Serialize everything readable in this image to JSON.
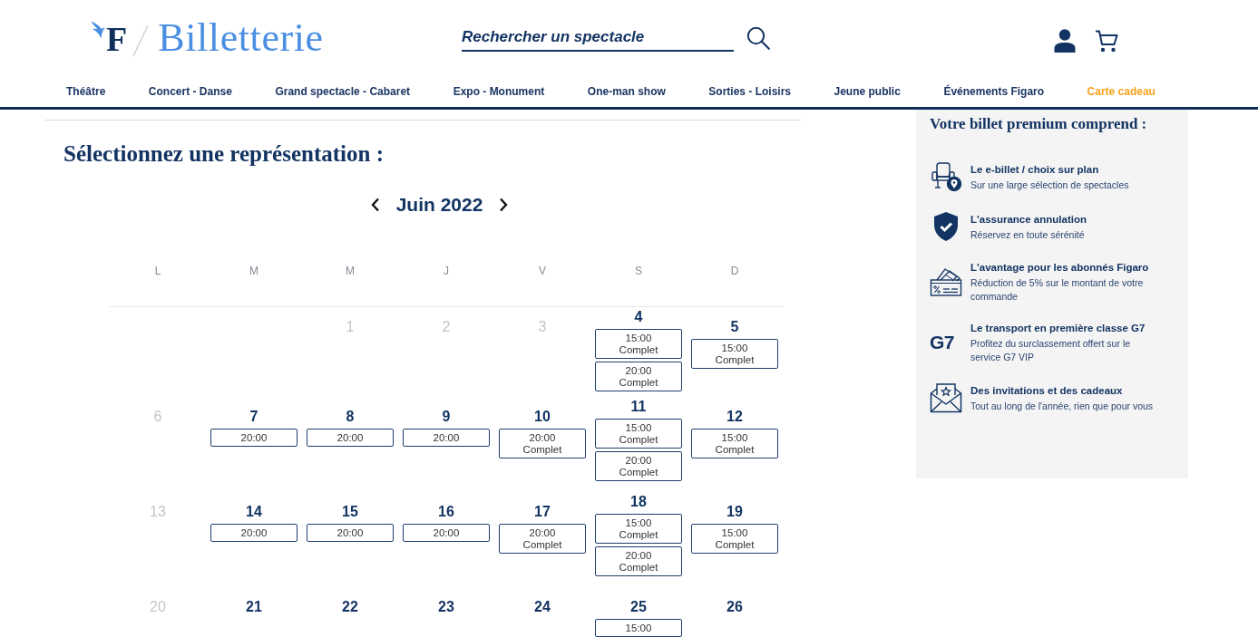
{
  "header": {
    "logo_letter": "F",
    "site_title": "Billetterie",
    "search": {
      "placeholder": "Rechercher un spectacle"
    }
  },
  "nav": [
    {
      "label": "Théâtre",
      "highlighted": false
    },
    {
      "label": "Concert - Danse",
      "highlighted": false
    },
    {
      "label": "Grand spectacle - Cabaret",
      "highlighted": false
    },
    {
      "label": "Expo - Monument",
      "highlighted": false
    },
    {
      "label": "One-man show",
      "highlighted": false
    },
    {
      "label": "Sorties - Loisirs",
      "highlighted": false
    },
    {
      "label": "Jeune public",
      "highlighted": false
    },
    {
      "label": "Événements Figaro",
      "highlighted": false
    },
    {
      "label": "Carte cadeau",
      "highlighted": true
    }
  ],
  "booking": {
    "title": "Sélectionnez une représentation :",
    "month": "Juin 2022",
    "weekdays": [
      "L",
      "M",
      "M",
      "J",
      "V",
      "S",
      "D"
    ],
    "weeks": [
      [
        {
          "day": "1",
          "available": false
        },
        {
          "day": "2",
          "available": false
        },
        {
          "day": "3",
          "available": false
        },
        {
          "day": "4",
          "available": true,
          "slots": [
            {
              "time": "15:00",
              "status": "Complet"
            },
            {
              "time": "20:00",
              "status": "Complet"
            }
          ]
        },
        {
          "day": "5",
          "available": true,
          "slots": [
            {
              "time": "15:00",
              "status": "Complet"
            }
          ]
        }
      ],
      [
        {
          "day": "6",
          "available": false
        },
        {
          "day": "7",
          "available": true,
          "slots": [
            {
              "time": "20:00"
            }
          ]
        },
        {
          "day": "8",
          "available": true,
          "slots": [
            {
              "time": "20:00"
            }
          ]
        },
        {
          "day": "9",
          "available": true,
          "slots": [
            {
              "time": "20:00"
            }
          ]
        },
        {
          "day": "10",
          "available": true,
          "slots": [
            {
              "time": "20:00",
              "status": "Complet"
            }
          ]
        },
        {
          "day": "11",
          "available": true,
          "slots": [
            {
              "time": "15:00",
              "status": "Complet"
            },
            {
              "time": "20:00",
              "status": "Complet"
            }
          ]
        },
        {
          "day": "12",
          "available": true,
          "slots": [
            {
              "time": "15:00",
              "status": "Complet"
            }
          ]
        }
      ],
      [
        {
          "day": "13",
          "available": false
        },
        {
          "day": "14",
          "available": true,
          "slots": [
            {
              "time": "20:00"
            }
          ]
        },
        {
          "day": "15",
          "available": true,
          "slots": [
            {
              "time": "20:00"
            }
          ]
        },
        {
          "day": "16",
          "available": true,
          "slots": [
            {
              "time": "20:00"
            }
          ]
        },
        {
          "day": "17",
          "available": true,
          "slots": [
            {
              "time": "20:00",
              "status": "Complet"
            }
          ]
        },
        {
          "day": "18",
          "available": true,
          "slots": [
            {
              "time": "15:00",
              "status": "Complet"
            },
            {
              "time": "20:00",
              "status": "Complet"
            }
          ]
        },
        {
          "day": "19",
          "available": true,
          "slots": [
            {
              "time": "15:00",
              "status": "Complet"
            }
          ]
        }
      ],
      [
        {
          "day": "20",
          "available": false
        },
        {
          "day": "21",
          "available": true
        },
        {
          "day": "22",
          "available": true
        },
        {
          "day": "23",
          "available": true
        },
        {
          "day": "24",
          "available": true
        },
        {
          "day": "25",
          "available": true,
          "slots": [
            {
              "time": "15:00"
            }
          ]
        },
        {
          "day": "26",
          "available": true
        }
      ]
    ]
  },
  "premium": {
    "title": "Votre billet premium comprend :",
    "items": [
      {
        "kind": "seat",
        "title": "Le e-billet / choix sur plan",
        "text": "Sur une large sélection de spectacles"
      },
      {
        "kind": "shield",
        "title": "L'assurance annulation",
        "text": "Réservez en toute sérénité"
      },
      {
        "kind": "tickets",
        "title": "L'avantage pour les abonnés Figaro",
        "text": "Réduction de 5% sur le montant de votre commande"
      },
      {
        "kind": "brand",
        "logo_text": "G7",
        "title": "Le transport en première classe G7",
        "text": "Profitez du surclassement offert sur le service G7 VIP"
      },
      {
        "kind": "envelope",
        "title": "Des invitations et des cadeaux",
        "text": "Tout au long de l'année, rien que pour vous"
      }
    ]
  }
}
